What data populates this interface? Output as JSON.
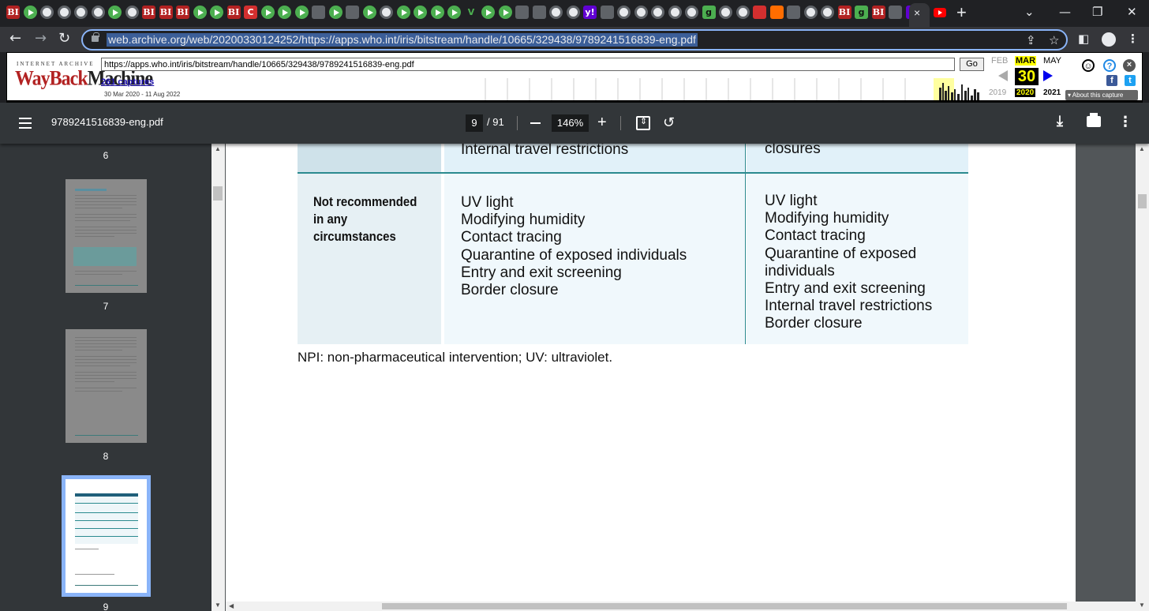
{
  "browser": {
    "active_tab_close": "×",
    "new_tab": "+",
    "window": {
      "tab_search": "⌄",
      "minimize": "—",
      "restore": "❐",
      "close": "✕"
    },
    "nav": {
      "back": "←",
      "forward": "→",
      "reload": "↻"
    },
    "url": "web.archive.org/web/20200330124252/https://apps.who.int/iris/bitstream/handle/10665/329438/9789241516839-eng.pdf",
    "tab_favicons": [
      "BI",
      "play",
      "globe",
      "globe",
      "globe",
      "globe",
      "play",
      "globe",
      "BI",
      "BI",
      "BI",
      "play",
      "play",
      "BI",
      "C",
      "play",
      "play",
      "play",
      "sq",
      "play",
      "sq",
      "play",
      "globe",
      "play",
      "play",
      "play",
      "play",
      "V",
      "play",
      "play",
      "sq",
      "sq",
      "globe",
      "globe",
      "y!",
      "sq",
      "globe",
      "globe",
      "globe",
      "globe",
      "globe",
      "g",
      "globe",
      "globe",
      "red",
      "org",
      "sq",
      "globe",
      "globe",
      "BI",
      "g",
      "BI",
      "sq",
      "ylw"
    ]
  },
  "wayback": {
    "ia_label": "INTERNET ARCHIVE",
    "logo_main": "WayBack",
    "logo_sub": "Machine",
    "input_url": "https://apps.who.int/iris/bitstream/handle/10665/329438/9789241516839-eng.pdf",
    "go_label": "Go",
    "captures_link": "261 captures",
    "capture_range": "30 Mar 2020 - 11 Aug 2022",
    "months": {
      "prev": "FEB",
      "current": "MAR",
      "next": "MAY"
    },
    "day": "30",
    "years": {
      "prev": "2019",
      "current": "2020",
      "next": "2021"
    },
    "about_label": "▾ About this capture",
    "icons": {
      "help": "?",
      "close": "×",
      "facebook": "f",
      "twitter": "t"
    }
  },
  "pdf_toolbar": {
    "file_name": "9789241516839-eng.pdf",
    "current_page": "9",
    "total_pages": "/ 91",
    "zoom": "146%",
    "zoom_in": "+",
    "rotate": "↺",
    "download": "⤓",
    "more": "⋮"
  },
  "sidebar": {
    "thumbnails": [
      {
        "label": "6"
      },
      {
        "label": "7"
      },
      {
        "label": "8"
      },
      {
        "label": "9"
      }
    ]
  },
  "document": {
    "top_row": {
      "col2": "Internal travel restrictions",
      "col3": "closures"
    },
    "row": {
      "header": "Not recommended in any circumstances",
      "col2_items": [
        "UV light",
        "Modifying humidity",
        "Contact tracing",
        "Quarantine of exposed individuals",
        "Entry and exit screening",
        "Border closure"
      ],
      "col3_items": [
        "UV light",
        "Modifying humidity",
        "Contact tracing",
        "Quarantine of exposed",
        "individuals",
        "Entry and exit screening",
        "Internal travel restrictions",
        "Border closure"
      ]
    },
    "footnote": "NPI: non-pharmaceutical intervention; UV: ultraviolet."
  }
}
